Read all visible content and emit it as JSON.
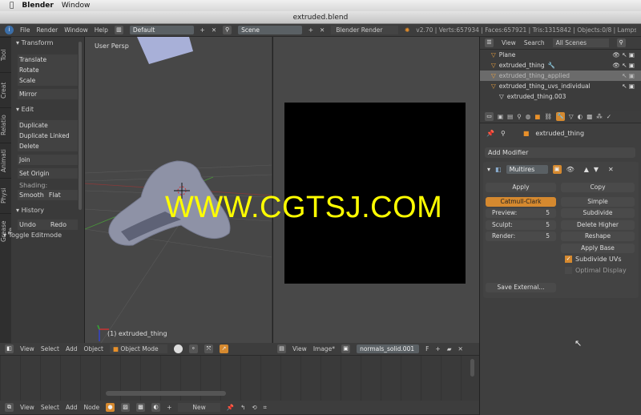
{
  "mac_menu": {
    "apple": "",
    "app": "Blender",
    "items": [
      "Window"
    ]
  },
  "window_title": "extruded.blend",
  "top_header": {
    "menus": [
      "File",
      "Render",
      "Window",
      "Help"
    ],
    "layout": "Default",
    "scene": "Scene",
    "engine": "Blender Render",
    "status": "v2.70 | Verts:657934 | Faces:657921 | Tris:1315842 | Objects:0/8 | Lamps"
  },
  "tool_tabs": [
    "Tool",
    "Creat",
    "Relatio",
    "Animati",
    "Physi",
    "Grease Pe"
  ],
  "tool_panel": {
    "transform": {
      "title": "Transform",
      "items": [
        "Translate",
        "Rotate",
        "Scale",
        "Mirror"
      ]
    },
    "edit": {
      "title": "Edit",
      "items": [
        "Duplicate",
        "Duplicate Linked",
        "Delete",
        "Join",
        "Set Origin"
      ],
      "shading_label": "Shading:",
      "smooth": "Smooth",
      "flat": "Flat"
    },
    "history": {
      "title": "History",
      "undo": "Undo",
      "redo": "Redo"
    },
    "toggle": "Toggle Editmode"
  },
  "viewport": {
    "label": "User Persp",
    "object_label": "(1) extruded_thing"
  },
  "watermark": "WWW.CGTSJ.COM",
  "view3d_header": {
    "menus": [
      "View",
      "Select",
      "Add",
      "Object"
    ],
    "mode": "Object Mode"
  },
  "image_header": {
    "menus": [
      "View",
      "Image*"
    ],
    "image": "normals_solid.001",
    "f": "F"
  },
  "node_header": {
    "menus": [
      "View",
      "Select",
      "Add",
      "Node"
    ],
    "new": "New"
  },
  "outliner": {
    "menus": [
      "View",
      "Search"
    ],
    "filter": "All Scenes",
    "rows": [
      "Plane",
      "extruded_thing",
      "extruded_thing_applied",
      "extruded_thing_uvs_individual",
      "extruded_thing.003"
    ]
  },
  "properties": {
    "object": "extruded_thing",
    "add_modifier": "Add Modifier",
    "modifier_name": "Multires",
    "apply": "Apply",
    "copy": "Copy",
    "catmull": "Catmull-Clark",
    "simple": "Simple",
    "preview_label": "Preview:",
    "preview": "5",
    "sculpt_label": "Sculpt:",
    "sculpt": "5",
    "render_label": "Render:",
    "render": "5",
    "subdivide": "Subdivide",
    "delete_higher": "Delete Higher",
    "reshape": "Reshape",
    "apply_base": "Apply Base",
    "subdivide_uvs": "Subdivide UVs",
    "subdivide_uvs_checked": true,
    "optimal_display": "Optimal Display",
    "optimal_display_checked": false,
    "save_external": "Save External..."
  },
  "colors": {
    "accent": "#d5892f",
    "watermark": "#ffff00",
    "selected_row": "#6b6b6b"
  }
}
